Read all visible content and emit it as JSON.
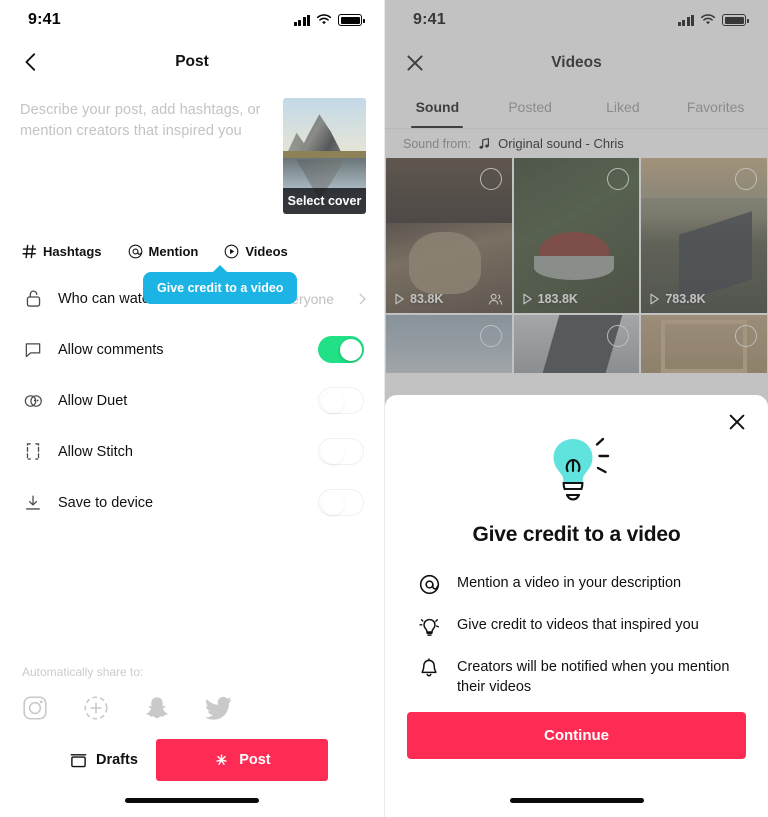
{
  "left": {
    "status": {
      "time": "9:41",
      "signal_icon": "signal-bars-icon",
      "wifi_icon": "wifi-icon",
      "battery_icon": "battery-icon"
    },
    "nav": {
      "back_icon": "back-chevron-icon",
      "title": "Post"
    },
    "compose": {
      "description_placeholder": "Describe your post, add hashtags, or mention creators that inspired you",
      "cover_label": "Select cover"
    },
    "chips": [
      {
        "icon": "hashtag-icon",
        "label": "Hashtags"
      },
      {
        "icon": "at-mention-icon",
        "label": "Mention"
      },
      {
        "icon": "play-circle-icon",
        "label": "Videos"
      }
    ],
    "tooltip": {
      "text": "Give credit to a video",
      "color": "#1BB4E4"
    },
    "settings": [
      {
        "icon": "unlock-icon",
        "label": "Who can watch this video",
        "type": "value",
        "value": "Everyone"
      },
      {
        "icon": "comment-bubble-icon",
        "label": "Allow comments",
        "type": "toggle",
        "state": "on"
      },
      {
        "icon": "duet-icon",
        "label": "Allow Duet",
        "type": "toggle",
        "state": "off"
      },
      {
        "icon": "stitch-icon",
        "label": "Allow Stitch",
        "type": "toggle",
        "state": "off"
      },
      {
        "icon": "download-icon",
        "label": "Save to device",
        "type": "toggle",
        "state": "off"
      }
    ],
    "share": {
      "label": "Automatically share to:",
      "icons": [
        "instagram-icon",
        "instagram-stories-icon",
        "snapchat-icon",
        "twitter-icon"
      ]
    },
    "footer": {
      "drafts_icon": "drafts-box-icon",
      "drafts_label": "Drafts",
      "post_icon": "sparkle-icon",
      "post_label": "Post",
      "post_color": "#FE2C55"
    }
  },
  "right": {
    "status": {
      "time": "9:41",
      "signal_icon": "signal-bars-icon",
      "wifi_icon": "wifi-icon",
      "battery_icon": "battery-icon"
    },
    "nav": {
      "close_icon": "close-x-icon",
      "title": "Videos"
    },
    "tabs": [
      {
        "label": "Sound",
        "active": true
      },
      {
        "label": "Posted",
        "active": false
      },
      {
        "label": "Liked",
        "active": false
      },
      {
        "label": "Favorites",
        "active": false
      }
    ],
    "sound_from": {
      "label": "Sound from:",
      "music_icon": "music-note-icon",
      "name": "Original sound - Chris"
    },
    "grid": [
      {
        "plays": "83.8K",
        "badge": "people-icon",
        "select_icon": "select-circle-icon"
      },
      {
        "plays": "183.8K",
        "badge": null,
        "select_icon": "select-circle-icon"
      },
      {
        "plays": "783.8K",
        "badge": null,
        "select_icon": "select-circle-icon"
      },
      {
        "plays": "",
        "badge": null,
        "select_icon": "select-circle-icon"
      },
      {
        "plays": "",
        "badge": null,
        "select_icon": "select-circle-icon"
      },
      {
        "plays": "",
        "badge": null,
        "select_icon": "select-circle-icon"
      }
    ],
    "sheet": {
      "close_icon": "close-x-icon",
      "hero_icon": "lightbulb-icon",
      "hero_color": "#5FE3DC",
      "heading": "Give credit to a video",
      "features": [
        {
          "icon": "at-mention-icon",
          "text": "Mention a video in your description"
        },
        {
          "icon": "lightbulb-small-icon",
          "text": "Give credit to videos that inspired you"
        },
        {
          "icon": "bell-icon",
          "text": "Creators will be notified when you mention their videos"
        }
      ],
      "continue_label": "Continue",
      "continue_color": "#FE2C55"
    }
  }
}
